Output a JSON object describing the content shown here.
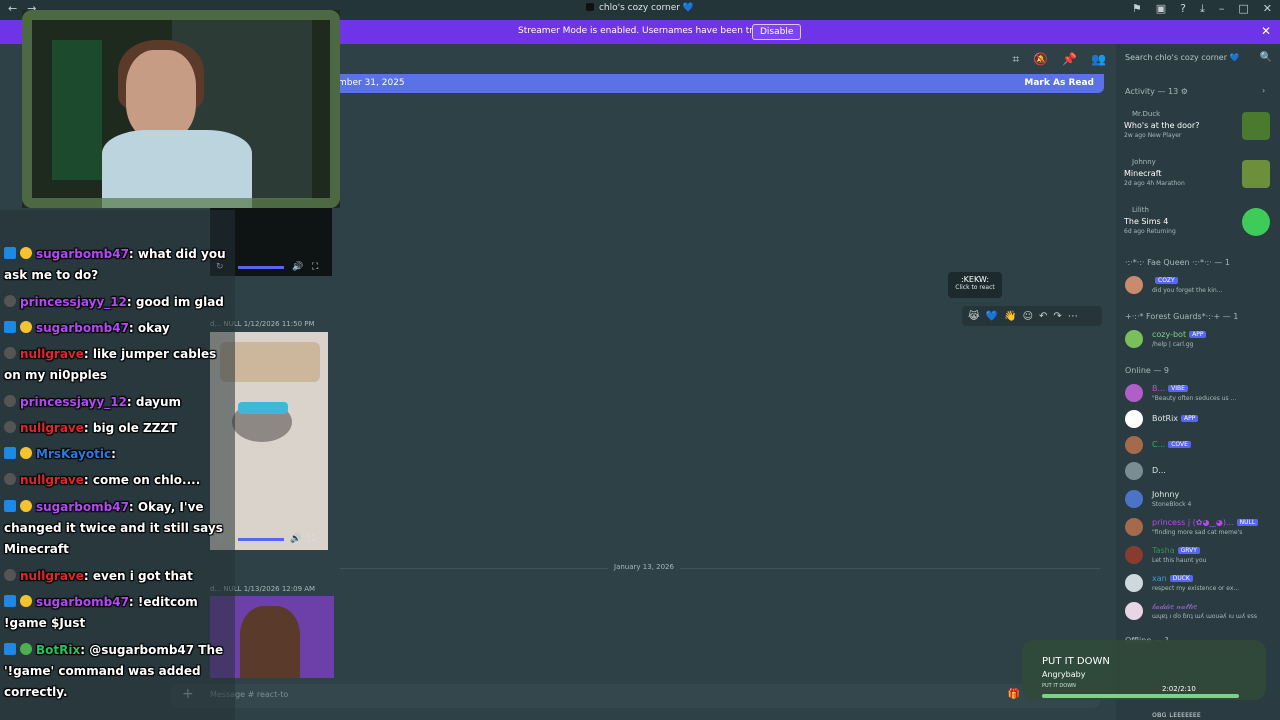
{
  "titlebar": {
    "title": "chlo's cozy corner 💙"
  },
  "banner": {
    "text": "Streamer Mode is enabled. Usernames have been truncated.",
    "button": "Disable"
  },
  "newbar": {
    "left": "mber 31, 2025",
    "right": "Mark As Read"
  },
  "search": {
    "placeholder": "Search chlo's cozy corner 💙"
  },
  "activity": {
    "header": "Activity — 13 ⚙",
    "items": [
      {
        "user": "Mr.Duck",
        "game": "Who's at the door?",
        "meta": "2w ago   New Player",
        "thumb": "#4a7a2e"
      },
      {
        "user": "Johnny",
        "game": "Minecraft",
        "meta": "2d ago   4h Marathon",
        "thumb": "#6b8f3a"
      },
      {
        "user": "Lilith",
        "game": "The Sims 4",
        "meta": "6d ago   Returning",
        "thumb": "#3ecb5a"
      }
    ]
  },
  "sections": {
    "fae": "·:·*·:· Fae Queen ·:·*·:· — 1",
    "forest": "+·:·* Forest Guards*·:·+ — 1",
    "online": "Online — 9",
    "offline": "Offline — ?"
  },
  "fae_member": {
    "name": "",
    "tag": "COZY",
    "status": "did you forget the kin..."
  },
  "forest_member": {
    "name": "cozy-bot",
    "tag": "APP",
    "status": "/help | carl.gg"
  },
  "online_members": [
    {
      "name": "B...",
      "tag": "VIBE",
      "status": "\"Beauty often seduces us ...",
      "color": "#c54fd1"
    },
    {
      "name": "BotRix",
      "tag": "APP",
      "status": "",
      "color": "#ffffff"
    },
    {
      "name": "C...",
      "tag": "COVE",
      "status": "",
      "color": "#2fb85c"
    },
    {
      "name": "D...",
      "tag": "",
      "status": "",
      "color": "#7a8d92"
    },
    {
      "name": "Johnny",
      "tag": "",
      "status": "StoneBlock 4",
      "color": "#4b74c9"
    },
    {
      "name": "princess j (✿◕‿◕)...",
      "tag": "NULL",
      "status": "\"finding more sad cat meme's",
      "color": "#b24bf3"
    },
    {
      "name": "Tasha",
      "tag": "GRVY",
      "status": "Let this haunt you",
      "color": "#3b8d5a"
    },
    {
      "name": "xan",
      "tag": "DUCK",
      "status": "respect my existence or ex...",
      "color": "#3b9ecf"
    },
    {
      "name": "𝒷𝒶𝒹𝒹𝒾𝑒 𝓃𝒶𝓉𝓉𝒾𝑒",
      "tag": "",
      "status": "ɯɥɐʇ ı ɗo ɓnʇ ɯʎ ɯouǝʎ ıu ɯʎ ɐss",
      "color": "#9c6ad6"
    }
  ],
  "messages": {
    "meta1": "d...   NULL   1/12/2026 11:50 PM",
    "date": "January 13, 2026",
    "meta2": "d...   NULL   1/13/2026 12:09 AM"
  },
  "tooltip": {
    "name": ":KEKW:",
    "hint": "Click to react"
  },
  "composer": {
    "placeholder": "Message #  react-to"
  },
  "chat": [
    {
      "name": "sugarbomb47",
      "text": ": what did you ask me to do?",
      "color": "n-purple",
      "badges": "a1"
    },
    {
      "name": "princessjayy_12",
      "text": ": good im glad",
      "color": "n-purple",
      "badges": "o"
    },
    {
      "name": "sugarbomb47",
      "text": ": okay",
      "color": "n-purple",
      "badges": "a1"
    },
    {
      "name": "nullgrave",
      "text": ": like jumper cables on my ni0pples",
      "color": "n-red",
      "badges": "o"
    },
    {
      "name": "princessjayy_12",
      "text": ": dayum",
      "color": "n-purple",
      "badges": "o"
    },
    {
      "name": "nullgrave",
      "text": ": big ole ZZZT",
      "color": "n-red",
      "badges": "o"
    },
    {
      "name": "MrsKayotic",
      "text": ":",
      "color": "n-blue",
      "badges": "a1"
    },
    {
      "name": "nullgrave",
      "text": ": come on chlo....",
      "color": "n-red",
      "badges": "o"
    },
    {
      "name": "sugarbomb47",
      "text": ": Okay, I've changed it twice and it still says Minecraft",
      "color": "n-purple",
      "badges": "a1"
    },
    {
      "name": "nullgrave",
      "text": ": even i got that",
      "color": "n-red",
      "badges": "o"
    },
    {
      "name": "sugarbomb47",
      "text": ": !editcom !game $Just",
      "color": "n-purple",
      "badges": "a1"
    },
    {
      "name": "BotRix",
      "text": ": @sugarbomb47 The '!game' command was added correctly.",
      "color": "n-green",
      "badges": "g"
    }
  ],
  "nowplaying": {
    "title": "PUT IT DOWN",
    "artist": "Angrybaby",
    "small": "PUT IT DOWN",
    "time": "2:02/2:10",
    "progress": 0.94
  },
  "bottom": {
    "name": "ᴏʙɢ ʟᴇᴇᴇᴇᴇᴇᴇ"
  }
}
